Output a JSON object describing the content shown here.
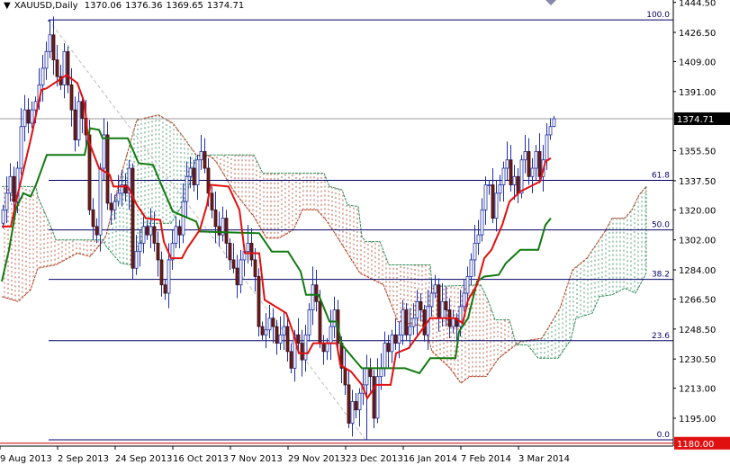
{
  "header": {
    "symbol": "XAUUSD,Daily",
    "open": "1370.06",
    "high": "1376.36",
    "low": "1369.65",
    "close": "1374.71"
  },
  "colors": {
    "bull_body": "#ffffff",
    "bull_outline": "#1f2fa8",
    "bear_body": "#6e1c1c",
    "wick": "#1f2fa8",
    "tenkan": "#e01010",
    "kijun": "#117a11",
    "cloud_bull": "#2e8b57",
    "cloud_bear": "#b04020",
    "fib": "#000066",
    "bid_line": "#999999",
    "support_line": "#cc0000"
  },
  "chart_data": {
    "type": "candlestick",
    "title": "XAUUSD,Daily",
    "ylim": [
      1177.5,
      1446
    ],
    "y_ticks": [
      "1444.50",
      "1426.50",
      "1409.00",
      "1391.00",
      "1355.50",
      "1337.50",
      "1320.00",
      "1302.00",
      "1284.00",
      "1266.50",
      "1248.50",
      "1230.50",
      "1213.00",
      "1195.00"
    ],
    "x_ticks": [
      {
        "bar": 0,
        "label": "9 Aug 2013"
      },
      {
        "bar": 16,
        "label": "2 Sep 2013"
      },
      {
        "bar": 32,
        "label": "24 Sep 2013"
      },
      {
        "bar": 48,
        "label": "16 Oct 2013"
      },
      {
        "bar": 64,
        "label": "7 Nov 2013"
      },
      {
        "bar": 80,
        "label": "29 Nov 2013"
      },
      {
        "bar": 96,
        "label": "23 Dec 2013"
      },
      {
        "bar": 112,
        "label": "16 Jan 2014"
      },
      {
        "bar": 128,
        "label": "7 Feb 2014"
      },
      {
        "bar": 144,
        "label": "3 Mar 2014"
      }
    ],
    "first_open": 1312,
    "closes": [
      1320,
      1330,
      1340,
      1325,
      1345,
      1370,
      1380,
      1372,
      1380,
      1385,
      1395,
      1405,
      1415,
      1425,
      1410,
      1400,
      1395,
      1415,
      1395,
      1380,
      1362,
      1385,
      1375,
      1365,
      1320,
      1310,
      1305,
      1345,
      1365,
      1324,
      1320,
      1325,
      1330,
      1335,
      1330,
      1345,
      1285,
      1295,
      1300,
      1310,
      1305,
      1310,
      1300,
      1290,
      1275,
      1270,
      1290,
      1300,
      1310,
      1305,
      1325,
      1340,
      1345,
      1335,
      1350,
      1355,
      1345,
      1330,
      1320,
      1310,
      1305,
      1315,
      1300,
      1290,
      1285,
      1275,
      1290,
      1295,
      1300,
      1290,
      1280,
      1250,
      1245,
      1248,
      1255,
      1250,
      1240,
      1245,
      1250,
      1235,
      1225,
      1245,
      1240,
      1230,
      1245,
      1260,
      1275,
      1265,
      1240,
      1235,
      1240,
      1250,
      1260,
      1240,
      1225,
      1215,
      1192,
      1205,
      1200,
      1210,
      1215,
      1225,
      1220,
      1195,
      1220,
      1225,
      1240,
      1235,
      1245,
      1240,
      1245,
      1260,
      1245,
      1250,
      1255,
      1265,
      1260,
      1245,
      1262,
      1270,
      1275,
      1255,
      1265,
      1260,
      1250,
      1255,
      1250,
      1262,
      1270,
      1280,
      1290,
      1300,
      1305,
      1320,
      1335,
      1335,
      1315,
      1330,
      1335,
      1345,
      1350,
      1335,
      1340,
      1330,
      1350,
      1355,
      1340,
      1345,
      1355,
      1340,
      1350,
      1365,
      1370,
      1374.71
    ],
    "high_extreme": {
      "bar": 13,
      "price": 1434
    },
    "low_extreme": {
      "bar": 101,
      "price": 1182
    },
    "ichimoku": {
      "tenkan": [
        [
          0,
          1310
        ],
        [
          2.5,
          1310
        ],
        [
          4.5,
          1330
        ],
        [
          8,
          1362
        ],
        [
          11,
          1392
        ],
        [
          12.5,
          1393
        ],
        [
          18,
          1401
        ],
        [
          21,
          1396
        ],
        [
          23,
          1384
        ],
        [
          24,
          1362
        ],
        [
          27,
          1345
        ],
        [
          30,
          1341
        ],
        [
          31,
          1334
        ],
        [
          35,
          1334
        ],
        [
          37.5,
          1323
        ],
        [
          40,
          1315
        ],
        [
          44,
          1314
        ],
        [
          45,
          1301
        ],
        [
          47,
          1291
        ],
        [
          50,
          1291
        ],
        [
          51.5,
          1297
        ],
        [
          55,
          1308
        ],
        [
          57,
          1323
        ],
        [
          58,
          1335
        ],
        [
          63,
          1334
        ],
        [
          66,
          1320
        ],
        [
          67.5,
          1294
        ],
        [
          71.5,
          1294
        ],
        [
          73,
          1266
        ],
        [
          79,
          1258
        ],
        [
          81,
          1246
        ],
        [
          82.5,
          1234
        ],
        [
          85,
          1234
        ],
        [
          86.5,
          1240
        ],
        [
          93,
          1240
        ],
        [
          94,
          1227
        ],
        [
          97,
          1223
        ],
        [
          100,
          1215
        ],
        [
          101.5,
          1207
        ],
        [
          104,
          1215
        ],
        [
          108,
          1215
        ],
        [
          109.5,
          1234
        ],
        [
          113,
          1237
        ],
        [
          119,
          1255
        ],
        [
          126,
          1255
        ],
        [
          128,
          1252
        ],
        [
          129.5,
          1266
        ],
        [
          132,
          1275
        ],
        [
          134,
          1291
        ],
        [
          136,
          1296
        ],
        [
          139,
          1311
        ],
        [
          141,
          1325
        ],
        [
          144,
          1331
        ],
        [
          149.5,
          1337
        ],
        [
          151,
          1349
        ],
        [
          152.5,
          1351
        ]
      ],
      "kijun": [
        [
          0,
          1277
        ],
        [
          2,
          1296
        ],
        [
          4,
          1321
        ],
        [
          6,
          1330
        ],
        [
          8,
          1328
        ],
        [
          9.5,
          1335
        ],
        [
          12.5,
          1353
        ],
        [
          23,
          1353
        ],
        [
          24.5,
          1369
        ],
        [
          27,
          1368
        ],
        [
          28,
          1363
        ],
        [
          35,
          1363
        ],
        [
          38,
          1348
        ],
        [
          42,
          1347
        ],
        [
          44.5,
          1334
        ],
        [
          47.5,
          1319
        ],
        [
          54,
          1313
        ],
        [
          55,
          1307
        ],
        [
          71.5,
          1306
        ],
        [
          75,
          1295
        ],
        [
          79.5,
          1295
        ],
        [
          83,
          1283
        ],
        [
          84.5,
          1269
        ],
        [
          88,
          1269
        ],
        [
          91,
          1253
        ],
        [
          93,
          1253
        ],
        [
          94.5,
          1239
        ],
        [
          98,
          1230
        ],
        [
          100,
          1225
        ],
        [
          112,
          1225
        ],
        [
          116,
          1222
        ],
        [
          119,
          1231
        ],
        [
          126,
          1231
        ],
        [
          127,
          1247
        ],
        [
          129.5,
          1255
        ],
        [
          132,
          1277
        ],
        [
          134,
          1280
        ],
        [
          138,
          1281
        ],
        [
          140,
          1288
        ],
        [
          144,
          1296
        ],
        [
          149,
          1296
        ],
        [
          151,
          1311
        ],
        [
          152.5,
          1315
        ]
      ],
      "span_a": [
        [
          0,
          1268
        ],
        [
          4.5,
          1265
        ],
        [
          8,
          1272
        ],
        [
          10,
          1285
        ],
        [
          15,
          1287
        ],
        [
          21,
          1294
        ],
        [
          24.5,
          1292
        ],
        [
          28,
          1301
        ],
        [
          29,
          1305
        ],
        [
          33,
          1340
        ],
        [
          37.5,
          1374
        ],
        [
          43.5,
          1377
        ],
        [
          47.5,
          1372
        ],
        [
          51,
          1362
        ],
        [
          54,
          1353
        ],
        [
          58,
          1352
        ],
        [
          59.5,
          1349
        ],
        [
          64.5,
          1331
        ],
        [
          70,
          1316
        ],
        [
          73.5,
          1303
        ],
        [
          77,
          1303
        ],
        [
          81,
          1308
        ],
        [
          83.5,
          1320
        ],
        [
          87.5,
          1320
        ],
        [
          90,
          1314
        ],
        [
          92.5,
          1306
        ],
        [
          99.5,
          1282
        ],
        [
          106,
          1275
        ],
        [
          110,
          1253
        ],
        [
          117.5,
          1250
        ],
        [
          119.5,
          1235
        ],
        [
          124.5,
          1225
        ],
        [
          127.5,
          1216
        ],
        [
          130,
          1220
        ],
        [
          134.5,
          1220
        ],
        [
          138,
          1231
        ],
        [
          144,
          1241
        ],
        [
          150,
          1243
        ],
        [
          152,
          1250
        ],
        [
          155,
          1261
        ],
        [
          158.5,
          1284
        ],
        [
          162.5,
          1291
        ],
        [
          167.5,
          1307
        ],
        [
          169.5,
          1315
        ],
        [
          173,
          1315
        ],
        [
          175,
          1320
        ],
        [
          177,
          1329
        ],
        [
          179,
          1334
        ]
      ],
      "span_b": [
        [
          0,
          1334
        ],
        [
          9.5,
          1334
        ],
        [
          10,
          1328
        ],
        [
          14,
          1308
        ],
        [
          15,
          1302
        ],
        [
          28,
          1302
        ],
        [
          29,
          1298
        ],
        [
          33,
          1288
        ],
        [
          36,
          1287
        ],
        [
          41,
          1312
        ],
        [
          47,
          1312
        ],
        [
          51,
          1326
        ],
        [
          54,
          1352
        ],
        [
          58,
          1353
        ],
        [
          70,
          1353
        ],
        [
          72.5,
          1342
        ],
        [
          89.5,
          1342
        ],
        [
          91,
          1334
        ],
        [
          94.5,
          1332
        ],
        [
          96,
          1323
        ],
        [
          99,
          1322
        ],
        [
          100,
          1304
        ],
        [
          101,
          1301
        ],
        [
          105,
          1301
        ],
        [
          107.5,
          1287
        ],
        [
          119,
          1287
        ],
        [
          119.5,
          1274
        ],
        [
          133,
          1275
        ],
        [
          135,
          1266
        ],
        [
          137,
          1254
        ],
        [
          141,
          1254
        ],
        [
          142.5,
          1242
        ],
        [
          143,
          1239
        ],
        [
          146,
          1239
        ],
        [
          149,
          1231
        ],
        [
          154.5,
          1231
        ],
        [
          158,
          1242
        ],
        [
          159.5,
          1255
        ],
        [
          164,
          1258
        ],
        [
          166,
          1268
        ],
        [
          169.5,
          1269
        ],
        [
          173,
          1273
        ],
        [
          176,
          1270
        ],
        [
          179,
          1282
        ]
      ]
    },
    "fibonacci": [
      {
        "label": "100.0",
        "price": 1434
      },
      {
        "label": "61.8",
        "price": 1337.7
      },
      {
        "label": "50.0",
        "price": 1308
      },
      {
        "label": "38.2",
        "price": 1278.3
      },
      {
        "label": "23.6",
        "price": 1241.5
      },
      {
        "label": "0.0",
        "price": 1182
      }
    ],
    "fib_start_bar": 13,
    "bid": {
      "price": 1374.71,
      "label": "1374.71"
    },
    "support": {
      "price": 1180,
      "label": "1180.00"
    }
  }
}
